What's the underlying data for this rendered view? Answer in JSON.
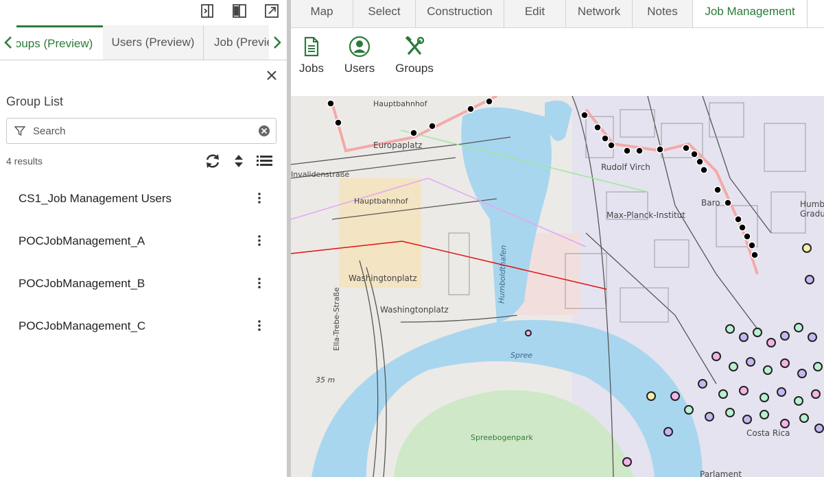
{
  "panel": {
    "tabs": [
      "Groups (Preview)",
      "Users (Preview)",
      "Job (Preview)"
    ],
    "active_tab": 0,
    "title": "Group List",
    "search_placeholder": "Search",
    "results": "4 results",
    "groups": [
      {
        "label": "CS1_Job Management Users"
      },
      {
        "label": "POCJobManagement_A"
      },
      {
        "label": "POCJobManagement_B"
      },
      {
        "label": "POCJobManagement_C"
      }
    ],
    "icons": {
      "dock": "dock-left-icon",
      "split": "split-view-icon",
      "popout": "popout-icon",
      "close": "close-icon",
      "filter": "filter-icon",
      "clear": "clear-search-icon",
      "refresh": "refresh-icon",
      "sort": "sort-icon",
      "list": "list-view-icon",
      "more": "more-options-icon"
    }
  },
  "toolbar": {
    "tabs": [
      "Map",
      "Select",
      "Construction",
      "Edit",
      "Network",
      "Notes",
      "Job Management"
    ],
    "active_tab": 6,
    "buttons": [
      {
        "label": "Jobs",
        "icon": "document-icon"
      },
      {
        "label": "Users",
        "icon": "user-icon"
      },
      {
        "label": "Groups",
        "icon": "tools-icon"
      }
    ]
  },
  "map": {
    "labels": [
      "Hauptbahnhof",
      "Europaplatz",
      "Hauptbahnhof",
      "Invalidenstraße",
      "Washingtonplatz",
      "Washingtonplatz",
      "Humboldthafen",
      "Spree",
      "Ella-Trebe-Straße",
      "35 m",
      "Spreebogenpark",
      "Rudolf Virch",
      "Max-Planck-Institut",
      "Baro",
      "Humb",
      "Graduate",
      "Costa Rica",
      "Parlament"
    ]
  },
  "colors": {
    "accent": "#2b7a3a",
    "water": "#a9d6ef",
    "park": "#cfe8c7",
    "route": "#f4a9a8",
    "line": "#e01010"
  }
}
